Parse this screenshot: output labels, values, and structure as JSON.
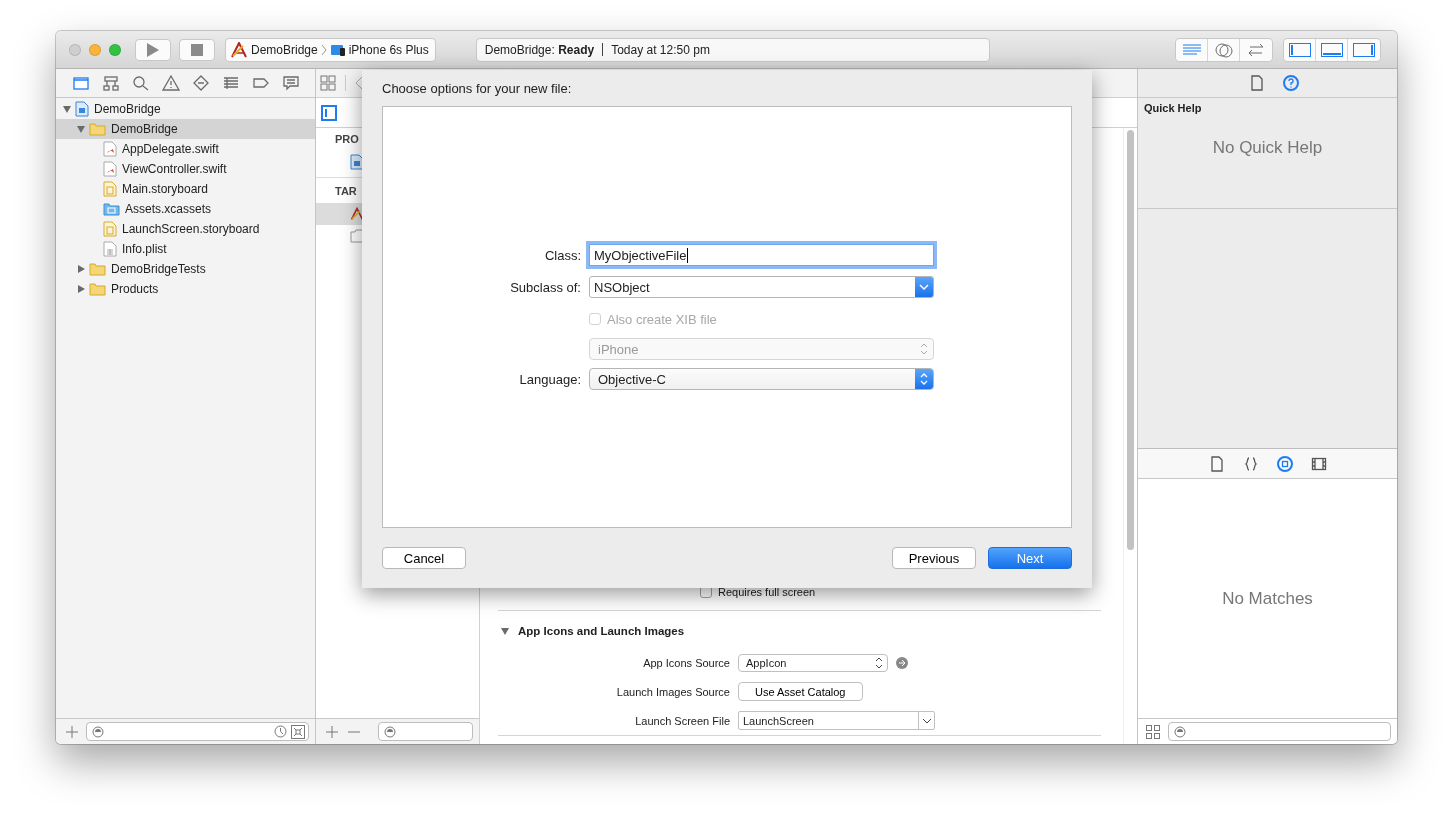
{
  "toolbar": {
    "scheme": {
      "target": "DemoBridge",
      "destination": "iPhone 6s Plus"
    },
    "activity": {
      "status": "DemoBridge: **Ready**",
      "time": "Today at 12:50 pm"
    },
    "editor_modes": [
      {
        "kind": "standard",
        "selected": true
      },
      {
        "kind": "assistant",
        "selected": false
      },
      {
        "kind": "version",
        "selected": false
      }
    ],
    "view_toggles": [
      {
        "kind": "navigator",
        "on": true
      },
      {
        "kind": "debug",
        "on": true
      },
      {
        "kind": "utilities",
        "on": true
      }
    ]
  },
  "navigator": {
    "tabs": [
      {
        "kind": "project",
        "selected": true
      },
      {
        "kind": "symbol",
        "selected": false
      },
      {
        "kind": "find",
        "selected": false
      },
      {
        "kind": "issue",
        "selected": false
      },
      {
        "kind": "test",
        "selected": false
      },
      {
        "kind": "debug",
        "selected": false
      },
      {
        "kind": "breakpoint",
        "selected": false
      },
      {
        "kind": "report",
        "selected": false
      }
    ],
    "tree": [
      {
        "name": "DemoBridge",
        "kind": "project",
        "expanded": true,
        "selected": false,
        "children": [
          {
            "name": "DemoBridge",
            "kind": "folder",
            "expanded": true,
            "selected": true,
            "children": [
              {
                "name": "AppDelegate.swift",
                "kind": "swift",
                "selected": false
              },
              {
                "name": "ViewController.swift",
                "kind": "swift",
                "selected": false
              },
              {
                "name": "Main.storyboard",
                "kind": "storyboard",
                "selected": false
              },
              {
                "name": "Assets.xcassets",
                "kind": "assets",
                "selected": false
              },
              {
                "name": "LaunchScreen.storyboard",
                "kind": "storyboard",
                "selected": false
              },
              {
                "name": "Info.plist",
                "kind": "plist",
                "selected": false
              }
            ]
          },
          {
            "name": "DemoBridgeTests",
            "kind": "folder",
            "expanded": false,
            "selected": false
          },
          {
            "name": "Products",
            "kind": "folder",
            "expanded": false,
            "selected": false
          }
        ]
      }
    ]
  },
  "targets_list": {
    "sections": [
      {
        "title": "PRO",
        "items": [
          {
            "kind": "project",
            "selected": false
          }
        ]
      },
      {
        "title": "TAR",
        "items": [
          {
            "kind": "target",
            "selected": true
          },
          {
            "kind": "bundle",
            "selected": false
          }
        ]
      }
    ]
  },
  "editor": {
    "requires_full_screen": {
      "label": "Requires full screen",
      "checked": false
    },
    "section": {
      "title": "App Icons and Launch Images",
      "expanded": true,
      "rows": [
        {
          "label": "App Icons Source",
          "kind": "popup",
          "value": "AppIcon"
        },
        {
          "label": "Launch Images Source",
          "kind": "button",
          "value": "Use Asset Catalog"
        },
        {
          "label": "Launch Screen File",
          "kind": "combo",
          "value": "LaunchScreen"
        }
      ]
    }
  },
  "sheet": {
    "title": "Choose options for your new file:",
    "fields": [
      {
        "kind": "text",
        "label": "Class:",
        "value": "MyObjectiveFile",
        "focused": true
      },
      {
        "kind": "combo",
        "label": "Subclass of:",
        "value": "NSObject"
      },
      {
        "kind": "checkbox",
        "label": "Also create XIB file",
        "checked": false,
        "disabled": true
      },
      {
        "kind": "popup",
        "value": "iPhone",
        "disabled": true
      },
      {
        "kind": "popup",
        "label": "Language:",
        "value": "Objective-C",
        "disabled": false
      }
    ],
    "buttons": [
      {
        "label": "Cancel",
        "default": false
      },
      {
        "label": "Previous",
        "default": false
      },
      {
        "label": "Next",
        "default": true
      }
    ]
  },
  "inspector": {
    "tabs": [
      {
        "kind": "file",
        "selected": false
      },
      {
        "kind": "help",
        "selected": true
      }
    ],
    "quick_help": {
      "title": "Quick Help",
      "empty_text": "No Quick Help"
    },
    "library": {
      "tabs": [
        {
          "kind": "file",
          "selected": false
        },
        {
          "kind": "snippet",
          "selected": false
        },
        {
          "kind": "object",
          "selected": true
        },
        {
          "kind": "media",
          "selected": false
        }
      ],
      "empty_text": "No Matches"
    }
  }
}
